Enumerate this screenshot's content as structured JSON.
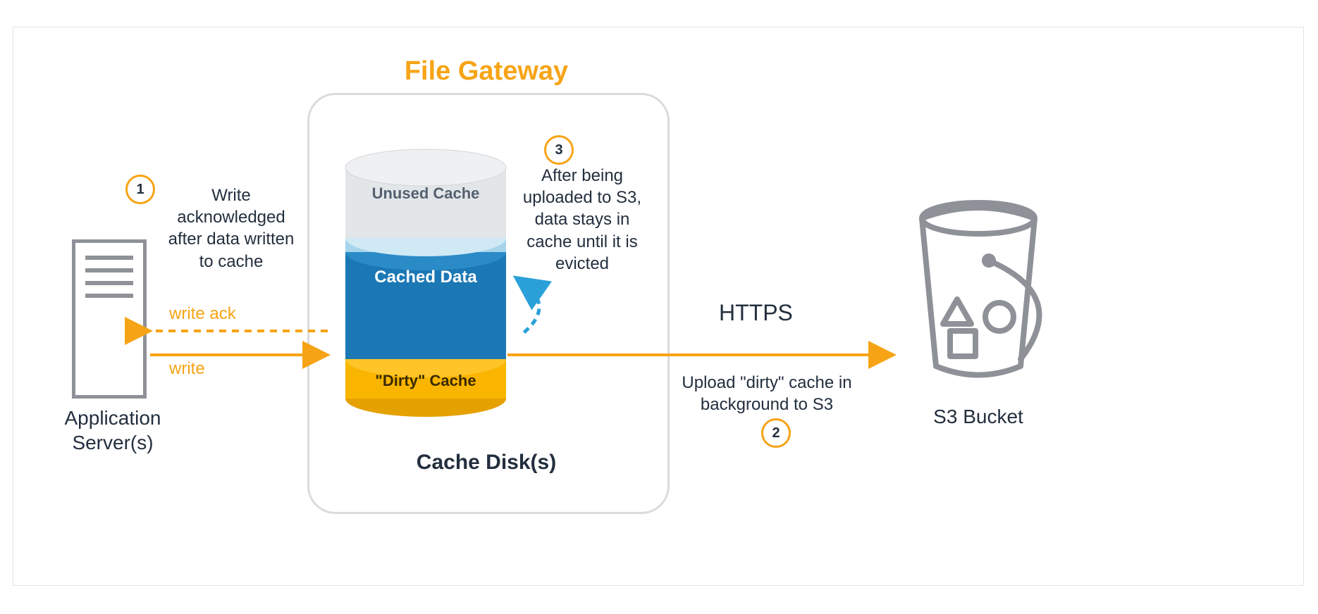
{
  "title": "File Gateway",
  "gateway_label": "Cache Disk(s)",
  "server_label": "Application\nServer(s)",
  "bucket_label": "S3 Bucket",
  "segments": {
    "unused": "Unused Cache",
    "cached": "Cached Data",
    "dirty": "\"Dirty\" Cache"
  },
  "steps": {
    "s1": "1",
    "s2": "2",
    "s3": "3"
  },
  "notes": {
    "n1": "Write acknowledged after data written to cache",
    "n2": "Upload \"dirty\" cache in background to S3",
    "n3": "After being uploaded to S3, data stays in cache until it is evicted"
  },
  "arrows": {
    "write": "write",
    "write_ack": "write ack",
    "https": "HTTPS"
  },
  "colors": {
    "orange": "#f6a416",
    "blue": "#1b78b4",
    "light_blue": "#2aa0d8",
    "yellow": "#f9b500",
    "grey": "#8e9197",
    "light_grey": "#d9dbde",
    "pale_grey": "#e3e6e9"
  }
}
